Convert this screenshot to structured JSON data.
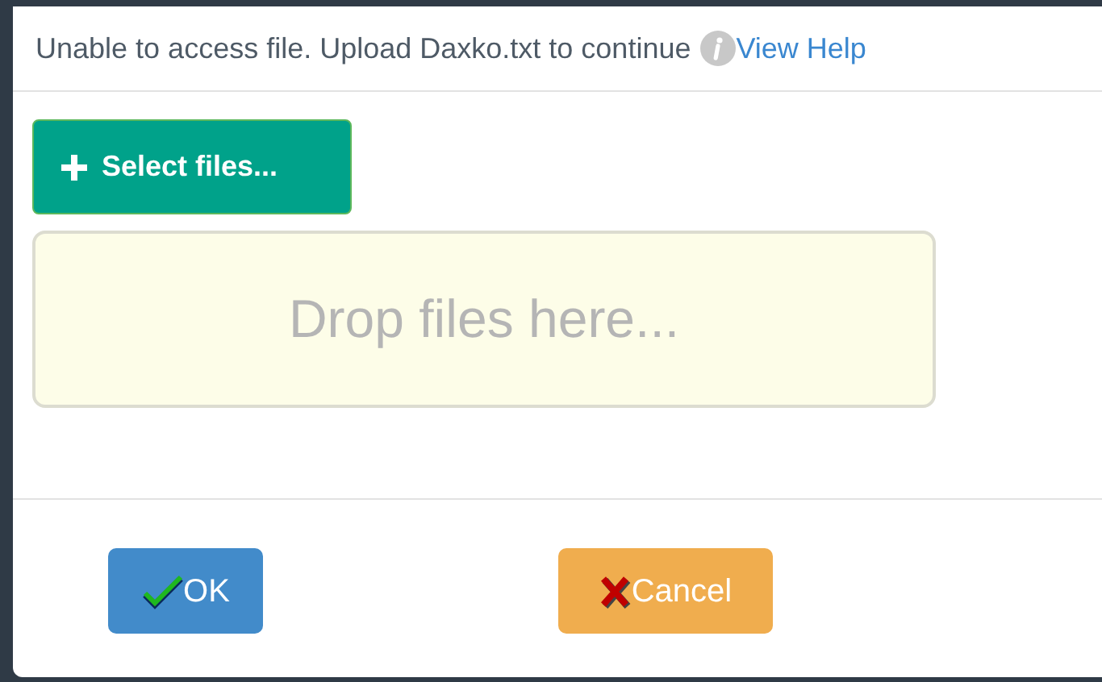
{
  "message": {
    "text": "Unable to access file. Upload Daxko.txt to continue",
    "link": "View Help"
  },
  "select_button": {
    "label": "Select files..."
  },
  "dropzone": {
    "placeholder": "Drop files here..."
  },
  "buttons": [
    {
      "kind": "ok",
      "label": "OK"
    },
    {
      "kind": "cancel",
      "label": "Cancel"
    }
  ]
}
